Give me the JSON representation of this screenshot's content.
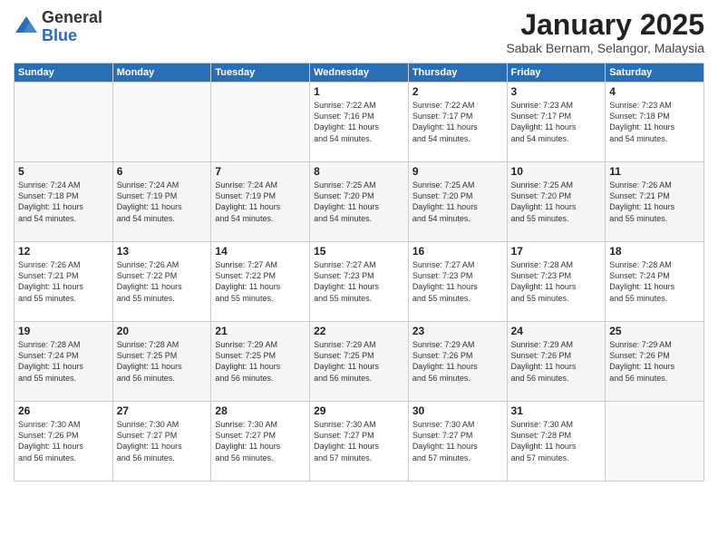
{
  "header": {
    "logo_general": "General",
    "logo_blue": "Blue",
    "month_title": "January 2025",
    "location": "Sabak Bernam, Selangor, Malaysia"
  },
  "weekdays": [
    "Sunday",
    "Monday",
    "Tuesday",
    "Wednesday",
    "Thursday",
    "Friday",
    "Saturday"
  ],
  "weeks": [
    [
      {
        "day": "",
        "info": ""
      },
      {
        "day": "",
        "info": ""
      },
      {
        "day": "",
        "info": ""
      },
      {
        "day": "1",
        "info": "Sunrise: 7:22 AM\nSunset: 7:16 PM\nDaylight: 11 hours\nand 54 minutes."
      },
      {
        "day": "2",
        "info": "Sunrise: 7:22 AM\nSunset: 7:17 PM\nDaylight: 11 hours\nand 54 minutes."
      },
      {
        "day": "3",
        "info": "Sunrise: 7:23 AM\nSunset: 7:17 PM\nDaylight: 11 hours\nand 54 minutes."
      },
      {
        "day": "4",
        "info": "Sunrise: 7:23 AM\nSunset: 7:18 PM\nDaylight: 11 hours\nand 54 minutes."
      }
    ],
    [
      {
        "day": "5",
        "info": "Sunrise: 7:24 AM\nSunset: 7:18 PM\nDaylight: 11 hours\nand 54 minutes."
      },
      {
        "day": "6",
        "info": "Sunrise: 7:24 AM\nSunset: 7:19 PM\nDaylight: 11 hours\nand 54 minutes."
      },
      {
        "day": "7",
        "info": "Sunrise: 7:24 AM\nSunset: 7:19 PM\nDaylight: 11 hours\nand 54 minutes."
      },
      {
        "day": "8",
        "info": "Sunrise: 7:25 AM\nSunset: 7:20 PM\nDaylight: 11 hours\nand 54 minutes."
      },
      {
        "day": "9",
        "info": "Sunrise: 7:25 AM\nSunset: 7:20 PM\nDaylight: 11 hours\nand 54 minutes."
      },
      {
        "day": "10",
        "info": "Sunrise: 7:25 AM\nSunset: 7:20 PM\nDaylight: 11 hours\nand 55 minutes."
      },
      {
        "day": "11",
        "info": "Sunrise: 7:26 AM\nSunset: 7:21 PM\nDaylight: 11 hours\nand 55 minutes."
      }
    ],
    [
      {
        "day": "12",
        "info": "Sunrise: 7:26 AM\nSunset: 7:21 PM\nDaylight: 11 hours\nand 55 minutes."
      },
      {
        "day": "13",
        "info": "Sunrise: 7:26 AM\nSunset: 7:22 PM\nDaylight: 11 hours\nand 55 minutes."
      },
      {
        "day": "14",
        "info": "Sunrise: 7:27 AM\nSunset: 7:22 PM\nDaylight: 11 hours\nand 55 minutes."
      },
      {
        "day": "15",
        "info": "Sunrise: 7:27 AM\nSunset: 7:23 PM\nDaylight: 11 hours\nand 55 minutes."
      },
      {
        "day": "16",
        "info": "Sunrise: 7:27 AM\nSunset: 7:23 PM\nDaylight: 11 hours\nand 55 minutes."
      },
      {
        "day": "17",
        "info": "Sunrise: 7:28 AM\nSunset: 7:23 PM\nDaylight: 11 hours\nand 55 minutes."
      },
      {
        "day": "18",
        "info": "Sunrise: 7:28 AM\nSunset: 7:24 PM\nDaylight: 11 hours\nand 55 minutes."
      }
    ],
    [
      {
        "day": "19",
        "info": "Sunrise: 7:28 AM\nSunset: 7:24 PM\nDaylight: 11 hours\nand 55 minutes."
      },
      {
        "day": "20",
        "info": "Sunrise: 7:28 AM\nSunset: 7:25 PM\nDaylight: 11 hours\nand 56 minutes."
      },
      {
        "day": "21",
        "info": "Sunrise: 7:29 AM\nSunset: 7:25 PM\nDaylight: 11 hours\nand 56 minutes."
      },
      {
        "day": "22",
        "info": "Sunrise: 7:29 AM\nSunset: 7:25 PM\nDaylight: 11 hours\nand 56 minutes."
      },
      {
        "day": "23",
        "info": "Sunrise: 7:29 AM\nSunset: 7:26 PM\nDaylight: 11 hours\nand 56 minutes."
      },
      {
        "day": "24",
        "info": "Sunrise: 7:29 AM\nSunset: 7:26 PM\nDaylight: 11 hours\nand 56 minutes."
      },
      {
        "day": "25",
        "info": "Sunrise: 7:29 AM\nSunset: 7:26 PM\nDaylight: 11 hours\nand 56 minutes."
      }
    ],
    [
      {
        "day": "26",
        "info": "Sunrise: 7:30 AM\nSunset: 7:26 PM\nDaylight: 11 hours\nand 56 minutes."
      },
      {
        "day": "27",
        "info": "Sunrise: 7:30 AM\nSunset: 7:27 PM\nDaylight: 11 hours\nand 56 minutes."
      },
      {
        "day": "28",
        "info": "Sunrise: 7:30 AM\nSunset: 7:27 PM\nDaylight: 11 hours\nand 56 minutes."
      },
      {
        "day": "29",
        "info": "Sunrise: 7:30 AM\nSunset: 7:27 PM\nDaylight: 11 hours\nand 57 minutes."
      },
      {
        "day": "30",
        "info": "Sunrise: 7:30 AM\nSunset: 7:27 PM\nDaylight: 11 hours\nand 57 minutes."
      },
      {
        "day": "31",
        "info": "Sunrise: 7:30 AM\nSunset: 7:28 PM\nDaylight: 11 hours\nand 57 minutes."
      },
      {
        "day": "",
        "info": ""
      }
    ]
  ]
}
